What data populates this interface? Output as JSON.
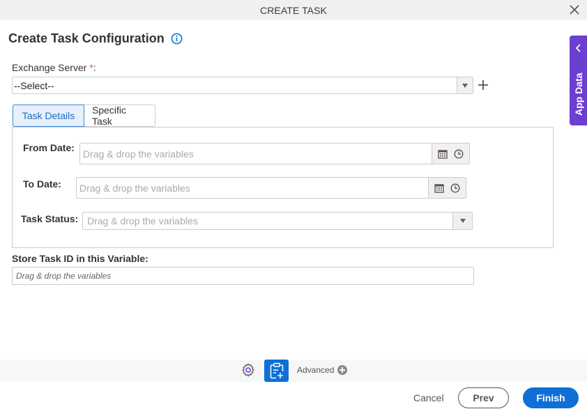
{
  "dialog": {
    "title": "CREATE TASK",
    "heading": "Create Task Configuration"
  },
  "side_panel": {
    "label": "App Data"
  },
  "exchange_server": {
    "label": "Exchange Server",
    "required_mark": "*",
    "label_suffix": ":",
    "selected": "--Select--"
  },
  "tabs": [
    {
      "label": "Task Details",
      "active": true
    },
    {
      "label": "Specific Task",
      "active": false
    }
  ],
  "task_details": {
    "from_date": {
      "label": "From Date:",
      "placeholder": "Drag & drop the variables"
    },
    "to_date": {
      "label": "To Date:",
      "placeholder": "Drag & drop the variables"
    },
    "task_status": {
      "label": "Task Status:",
      "placeholder": "Drag & drop the variables"
    }
  },
  "store_task_id": {
    "label": "Store Task ID in this Variable:",
    "placeholder": "Drag & drop the variables"
  },
  "toolbar": {
    "advanced_label": "Advanced"
  },
  "footer": {
    "cancel": "Cancel",
    "prev": "Prev",
    "finish": "Finish"
  },
  "colors": {
    "accent": "#0f6fd6",
    "side_panel": "#6b3fd1",
    "required": "#d9534f"
  }
}
